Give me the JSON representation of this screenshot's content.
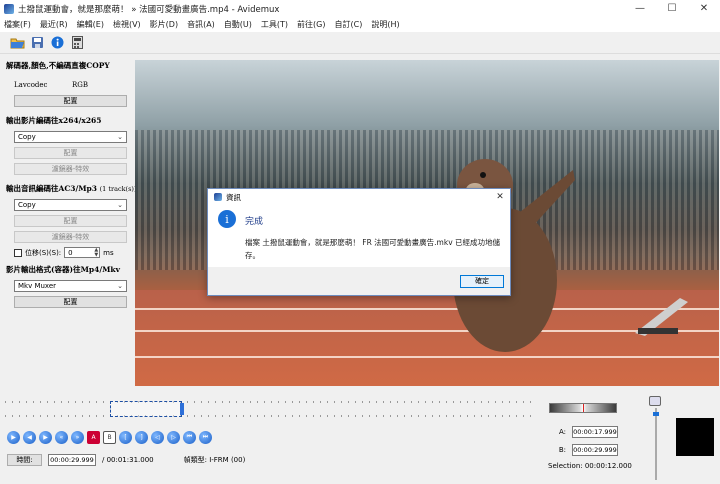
{
  "window": {
    "title": "土撥鼠運動會，就是那麼萌！ » 法國可愛動畫廣告.mp4 - Avidemux",
    "minimize": "—",
    "maximize": "☐",
    "close": "✕"
  },
  "menu": [
    "檔案(F)",
    "最近(R)",
    "編輯(E)",
    "檢視(V)",
    "影片(D)",
    "音訊(A)",
    "自動(U)",
    "工具(T)",
    "前往(G)",
    "自訂(C)",
    "說明(H)"
  ],
  "left_panel": {
    "video_decoder": {
      "heading": "解碼器,顏色,不編碼直複COPY",
      "codec_label": "Lavcodec",
      "codec_value": "RGB",
      "config_label": "配置"
    },
    "video_output": {
      "heading": "輸出影片編碼往x264/x265",
      "selected": "Copy",
      "config_label": "配置",
      "filters_label": "濾鏡器-特效"
    },
    "audio_output": {
      "heading": "輸出音訊編碼往AC3/Mp3",
      "heading_suffix": "(1 track(s))",
      "selected": "Copy",
      "config_label": "配置",
      "filters_label": "濾鏡器-特效",
      "shift_label": "位移(S)(S):",
      "shift_value": "0",
      "shift_unit": "ms"
    },
    "container": {
      "heading": "影片輸出格式(容器)往Mp4/Mkv",
      "selected": "Mkv Muxer",
      "config_label": "配置"
    }
  },
  "dialog": {
    "title": "資訊",
    "close": "✕",
    "heading": "完成",
    "message": "檔案 土撥鼠運動會，就是那麼萌！ FR 法國可愛動畫廣告.mkv 已經成功地儲存。",
    "ok_label": "確定"
  },
  "bottom": {
    "time_button": "時間:",
    "current_time": "00:00:29.999",
    "total_time": "/ 00:01:31.000",
    "frame_type": "幀類型:  I-FRM (00)",
    "marker_a_label": "A:",
    "marker_a": "00:00:17.999",
    "marker_b_label": "B:",
    "marker_b": "00:00:29.999",
    "selection": "Selection: 00:00:12.000"
  },
  "colors": {
    "accent": "#1a6fd6",
    "dialog_heading": "#1f3c8a"
  }
}
